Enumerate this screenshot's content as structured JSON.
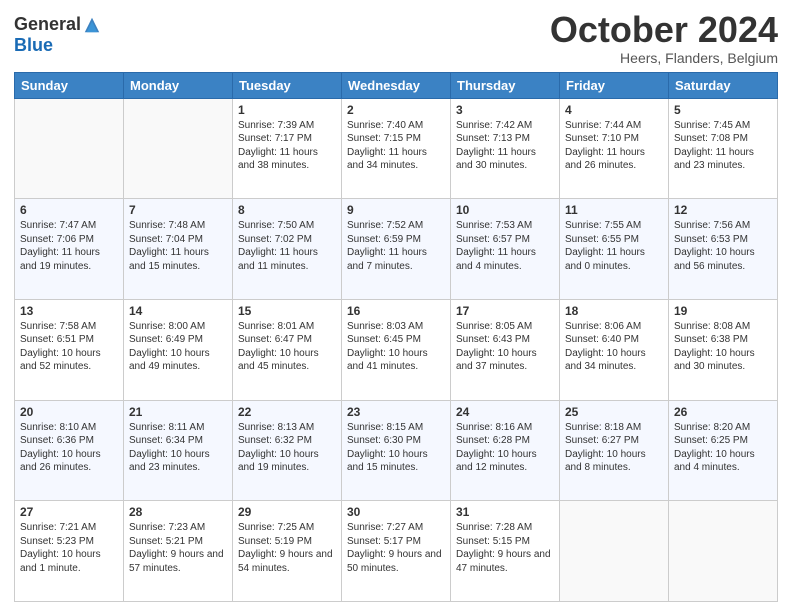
{
  "header": {
    "logo_line1": "General",
    "logo_line2": "Blue",
    "month": "October 2024",
    "location": "Heers, Flanders, Belgium"
  },
  "days_of_week": [
    "Sunday",
    "Monday",
    "Tuesday",
    "Wednesday",
    "Thursday",
    "Friday",
    "Saturday"
  ],
  "weeks": [
    [
      {
        "day": "",
        "info": ""
      },
      {
        "day": "",
        "info": ""
      },
      {
        "day": "1",
        "info": "Sunrise: 7:39 AM\nSunset: 7:17 PM\nDaylight: 11 hours and 38 minutes."
      },
      {
        "day": "2",
        "info": "Sunrise: 7:40 AM\nSunset: 7:15 PM\nDaylight: 11 hours and 34 minutes."
      },
      {
        "day": "3",
        "info": "Sunrise: 7:42 AM\nSunset: 7:13 PM\nDaylight: 11 hours and 30 minutes."
      },
      {
        "day": "4",
        "info": "Sunrise: 7:44 AM\nSunset: 7:10 PM\nDaylight: 11 hours and 26 minutes."
      },
      {
        "day": "5",
        "info": "Sunrise: 7:45 AM\nSunset: 7:08 PM\nDaylight: 11 hours and 23 minutes."
      }
    ],
    [
      {
        "day": "6",
        "info": "Sunrise: 7:47 AM\nSunset: 7:06 PM\nDaylight: 11 hours and 19 minutes."
      },
      {
        "day": "7",
        "info": "Sunrise: 7:48 AM\nSunset: 7:04 PM\nDaylight: 11 hours and 15 minutes."
      },
      {
        "day": "8",
        "info": "Sunrise: 7:50 AM\nSunset: 7:02 PM\nDaylight: 11 hours and 11 minutes."
      },
      {
        "day": "9",
        "info": "Sunrise: 7:52 AM\nSunset: 6:59 PM\nDaylight: 11 hours and 7 minutes."
      },
      {
        "day": "10",
        "info": "Sunrise: 7:53 AM\nSunset: 6:57 PM\nDaylight: 11 hours and 4 minutes."
      },
      {
        "day": "11",
        "info": "Sunrise: 7:55 AM\nSunset: 6:55 PM\nDaylight: 11 hours and 0 minutes."
      },
      {
        "day": "12",
        "info": "Sunrise: 7:56 AM\nSunset: 6:53 PM\nDaylight: 10 hours and 56 minutes."
      }
    ],
    [
      {
        "day": "13",
        "info": "Sunrise: 7:58 AM\nSunset: 6:51 PM\nDaylight: 10 hours and 52 minutes."
      },
      {
        "day": "14",
        "info": "Sunrise: 8:00 AM\nSunset: 6:49 PM\nDaylight: 10 hours and 49 minutes."
      },
      {
        "day": "15",
        "info": "Sunrise: 8:01 AM\nSunset: 6:47 PM\nDaylight: 10 hours and 45 minutes."
      },
      {
        "day": "16",
        "info": "Sunrise: 8:03 AM\nSunset: 6:45 PM\nDaylight: 10 hours and 41 minutes."
      },
      {
        "day": "17",
        "info": "Sunrise: 8:05 AM\nSunset: 6:43 PM\nDaylight: 10 hours and 37 minutes."
      },
      {
        "day": "18",
        "info": "Sunrise: 8:06 AM\nSunset: 6:40 PM\nDaylight: 10 hours and 34 minutes."
      },
      {
        "day": "19",
        "info": "Sunrise: 8:08 AM\nSunset: 6:38 PM\nDaylight: 10 hours and 30 minutes."
      }
    ],
    [
      {
        "day": "20",
        "info": "Sunrise: 8:10 AM\nSunset: 6:36 PM\nDaylight: 10 hours and 26 minutes."
      },
      {
        "day": "21",
        "info": "Sunrise: 8:11 AM\nSunset: 6:34 PM\nDaylight: 10 hours and 23 minutes."
      },
      {
        "day": "22",
        "info": "Sunrise: 8:13 AM\nSunset: 6:32 PM\nDaylight: 10 hours and 19 minutes."
      },
      {
        "day": "23",
        "info": "Sunrise: 8:15 AM\nSunset: 6:30 PM\nDaylight: 10 hours and 15 minutes."
      },
      {
        "day": "24",
        "info": "Sunrise: 8:16 AM\nSunset: 6:28 PM\nDaylight: 10 hours and 12 minutes."
      },
      {
        "day": "25",
        "info": "Sunrise: 8:18 AM\nSunset: 6:27 PM\nDaylight: 10 hours and 8 minutes."
      },
      {
        "day": "26",
        "info": "Sunrise: 8:20 AM\nSunset: 6:25 PM\nDaylight: 10 hours and 4 minutes."
      }
    ],
    [
      {
        "day": "27",
        "info": "Sunrise: 7:21 AM\nSunset: 5:23 PM\nDaylight: 10 hours and 1 minute."
      },
      {
        "day": "28",
        "info": "Sunrise: 7:23 AM\nSunset: 5:21 PM\nDaylight: 9 hours and 57 minutes."
      },
      {
        "day": "29",
        "info": "Sunrise: 7:25 AM\nSunset: 5:19 PM\nDaylight: 9 hours and 54 minutes."
      },
      {
        "day": "30",
        "info": "Sunrise: 7:27 AM\nSunset: 5:17 PM\nDaylight: 9 hours and 50 minutes."
      },
      {
        "day": "31",
        "info": "Sunrise: 7:28 AM\nSunset: 5:15 PM\nDaylight: 9 hours and 47 minutes."
      },
      {
        "day": "",
        "info": ""
      },
      {
        "day": "",
        "info": ""
      }
    ]
  ]
}
